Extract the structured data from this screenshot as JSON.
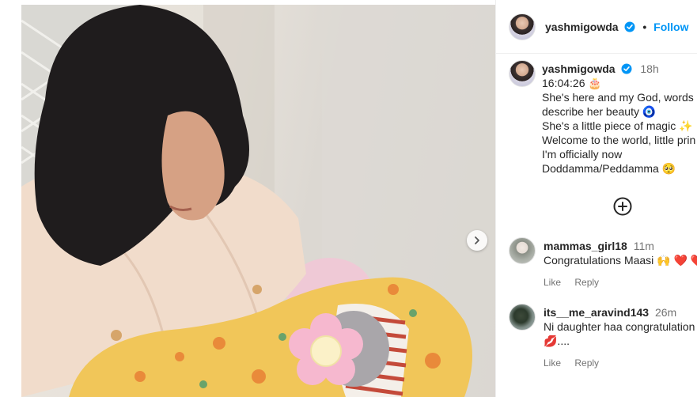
{
  "header": {
    "username": "yashmigowda",
    "separator": "•",
    "follow_label": "Follow"
  },
  "caption": {
    "username": "yashmigowda",
    "time": "18h",
    "lines": [
      "16:04:26 🎂",
      "She's here and my God, words c",
      "describe her beauty 🧿",
      "She's a little piece of magic ✨",
      "Welcome to the world, little prin",
      "I'm officially now",
      "Doddamma/Peddamma 🥺"
    ]
  },
  "comments": [
    {
      "username": "mammas_girl18",
      "time": "11m",
      "text": "Congratulations Maasi 🙌 ❤️ ❤️",
      "like": "Like",
      "reply": "Reply"
    },
    {
      "username": "its__me_aravind143",
      "time": "26m",
      "text": "Ni daughter haa congratulation",
      "text2": "💋....",
      "like": "Like",
      "reply": "Reply"
    }
  ],
  "icons": {
    "verified": "verified-badge-icon",
    "more_comments": "plus-circle-icon",
    "next": "chevron-right-icon"
  },
  "colors": {
    "link": "#0095f6",
    "verified": "#0095f6",
    "muted": "#737373",
    "text": "#262626"
  }
}
